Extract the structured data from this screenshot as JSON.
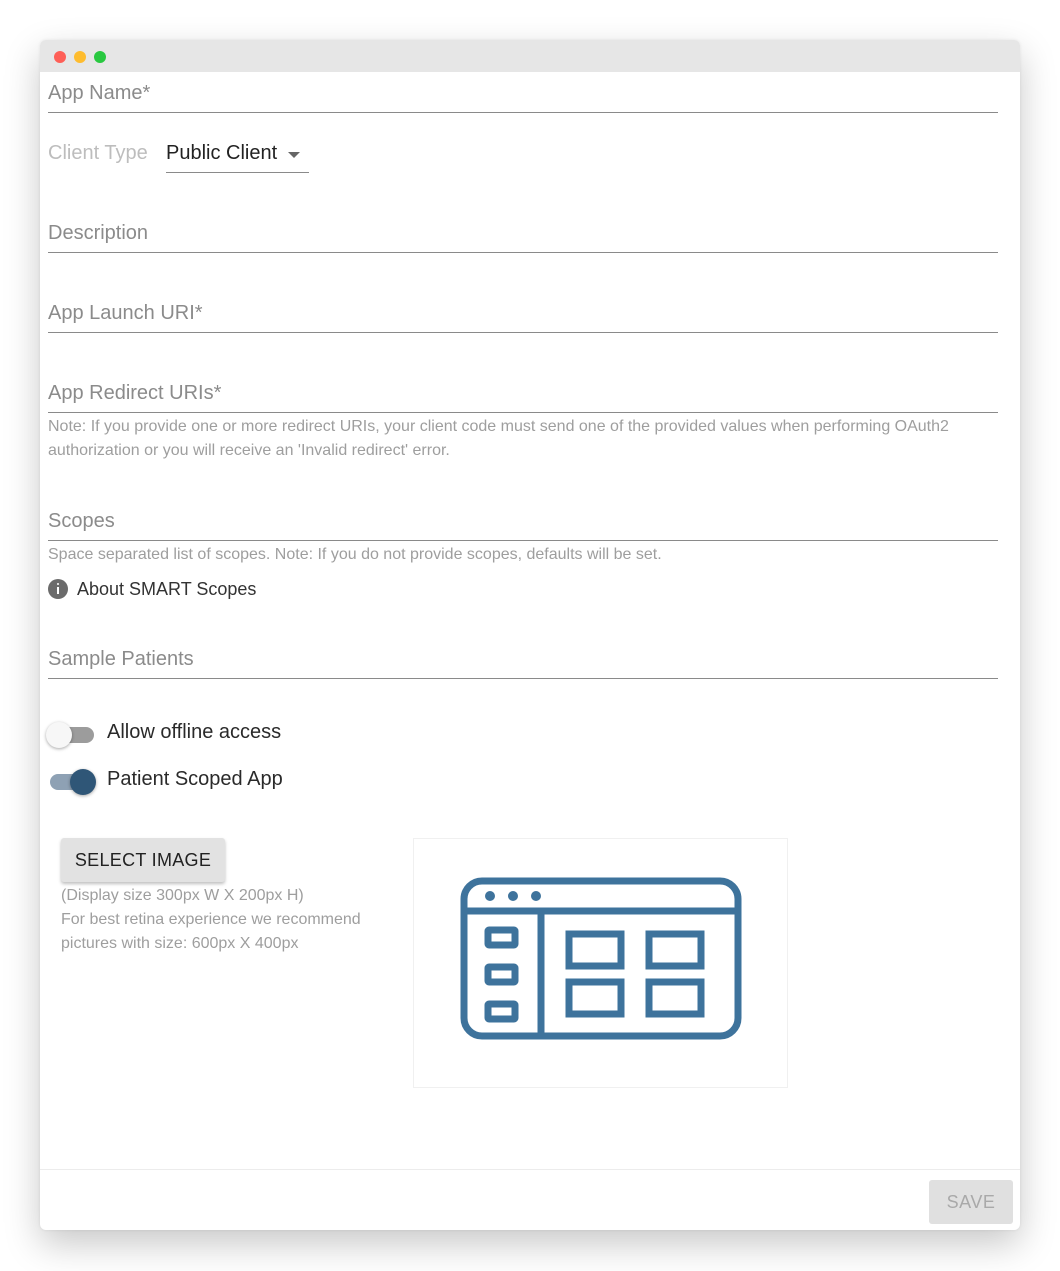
{
  "window": {
    "traffic_lights": [
      "close",
      "minimize",
      "maximize"
    ]
  },
  "form": {
    "app_name_label": "App Name*",
    "client_type": {
      "label": "Client Type",
      "value": "Public Client"
    },
    "description_label": "Description",
    "launch_uri_label": "App Launch URI*",
    "redirect_uris_label": "App Redirect URIs*",
    "redirect_note": "Note: If you provide one or more redirect URIs, your client code must send one of the provided values when performing OAuth2 authorization or you will receive an 'Invalid redirect' error.",
    "scopes_label": "Scopes",
    "scopes_note": "Space separated list of scopes. Note: If you do not provide scopes, defaults will be set.",
    "about_scopes_link": "About SMART Scopes",
    "sample_patients_label": "Sample Patients",
    "offline_access": {
      "label": "Allow offline access",
      "checked": false
    },
    "patient_scoped": {
      "label": "Patient Scoped App",
      "checked": true
    },
    "select_image_button": "SELECT IMAGE",
    "image_note": [
      "(Display size 300px W X 200px H)",
      "For best retina experience we recommend",
      "pictures with size: 600px X 400px"
    ],
    "preview_icon": "app-window-icon",
    "save_button": "SAVE"
  },
  "colors": {
    "accent": "#2f5677",
    "preview_icon": "#3e739c",
    "label": "#8b8b8b",
    "helper": "#9e9e9e"
  }
}
